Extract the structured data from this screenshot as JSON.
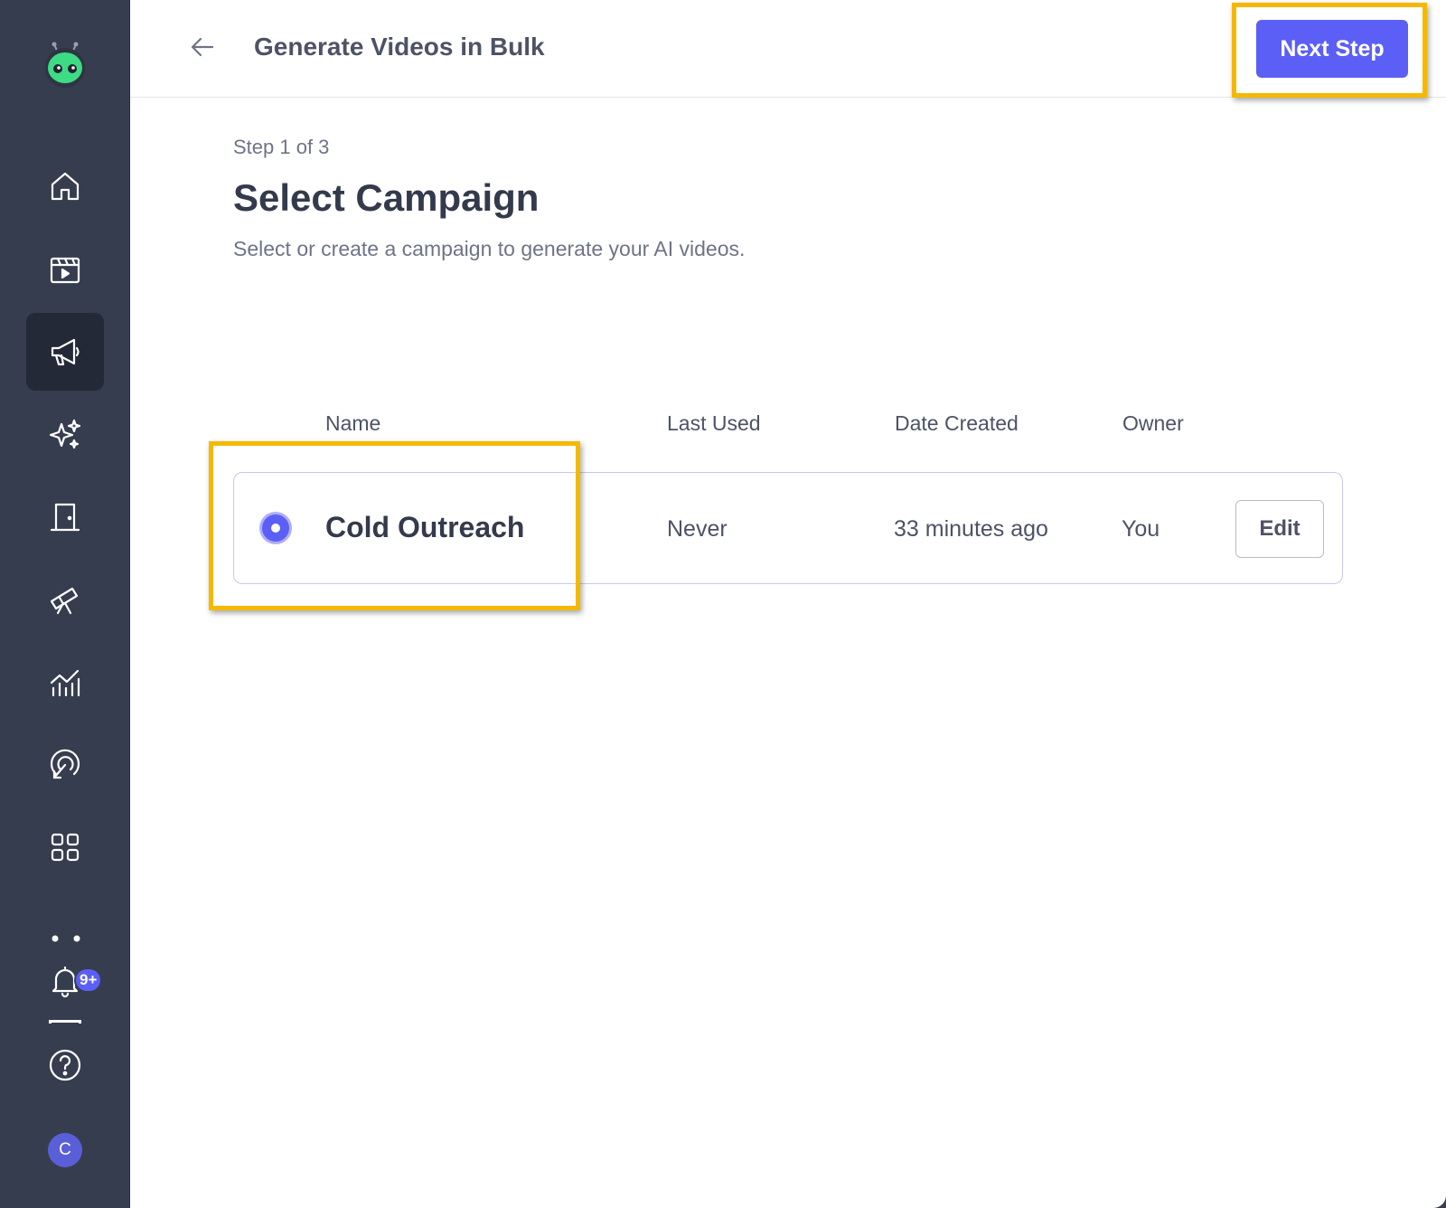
{
  "header": {
    "title": "Generate Videos in Bulk",
    "next_label": "Next Step"
  },
  "sidebar": {
    "items": [
      {
        "icon": "home-icon"
      },
      {
        "icon": "video-clapper-icon"
      },
      {
        "icon": "megaphone-icon",
        "active": true
      },
      {
        "icon": "sparkles-icon"
      },
      {
        "icon": "door-icon"
      },
      {
        "icon": "telescope-icon"
      },
      {
        "icon": "analytics-icon"
      },
      {
        "icon": "target-pointer-icon"
      },
      {
        "icon": "apps-grid-icon"
      }
    ],
    "notifications_badge": "9+",
    "avatar_initial": "C"
  },
  "main": {
    "step": "Step 1 of 3",
    "title": "Select Campaign",
    "subtitle": "Select or create a campaign to generate your AI videos.",
    "table": {
      "columns": [
        "Name",
        "Last Used",
        "Date Created",
        "Owner"
      ],
      "rows": [
        {
          "name": "Cold Outreach",
          "last_used": "Never",
          "date_created": "33 minutes ago",
          "owner": "You",
          "selected": true,
          "edit_label": "Edit"
        }
      ]
    }
  },
  "colors": {
    "accent": "#5b5ff5",
    "sidebar": "#363d4f",
    "highlight": "#f5b800"
  }
}
